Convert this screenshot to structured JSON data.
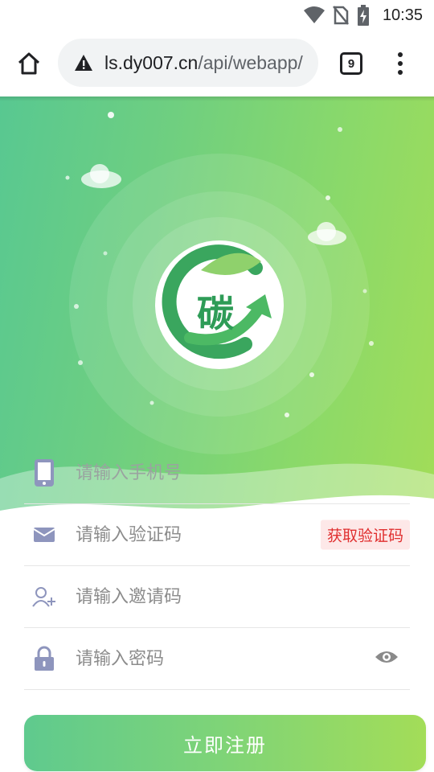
{
  "status_bar": {
    "time": "10:35"
  },
  "browser": {
    "url_host": "ls.dy007.cn",
    "url_path": "/api/webapp/",
    "tab_count": "9"
  },
  "logo": {
    "char": "碳"
  },
  "form": {
    "phone_placeholder": "请输入手机号",
    "code_placeholder": "请输入验证码",
    "get_code_label": "获取验证码",
    "invite_placeholder": "请输入邀请码",
    "password_placeholder": "请输入密码",
    "submit_label": "立即注册"
  },
  "colors": {
    "accent_start": "#58c891",
    "accent_end": "#a2dd58",
    "logo_green": "#3aa65e",
    "get_code_text": "#e02f2f"
  }
}
